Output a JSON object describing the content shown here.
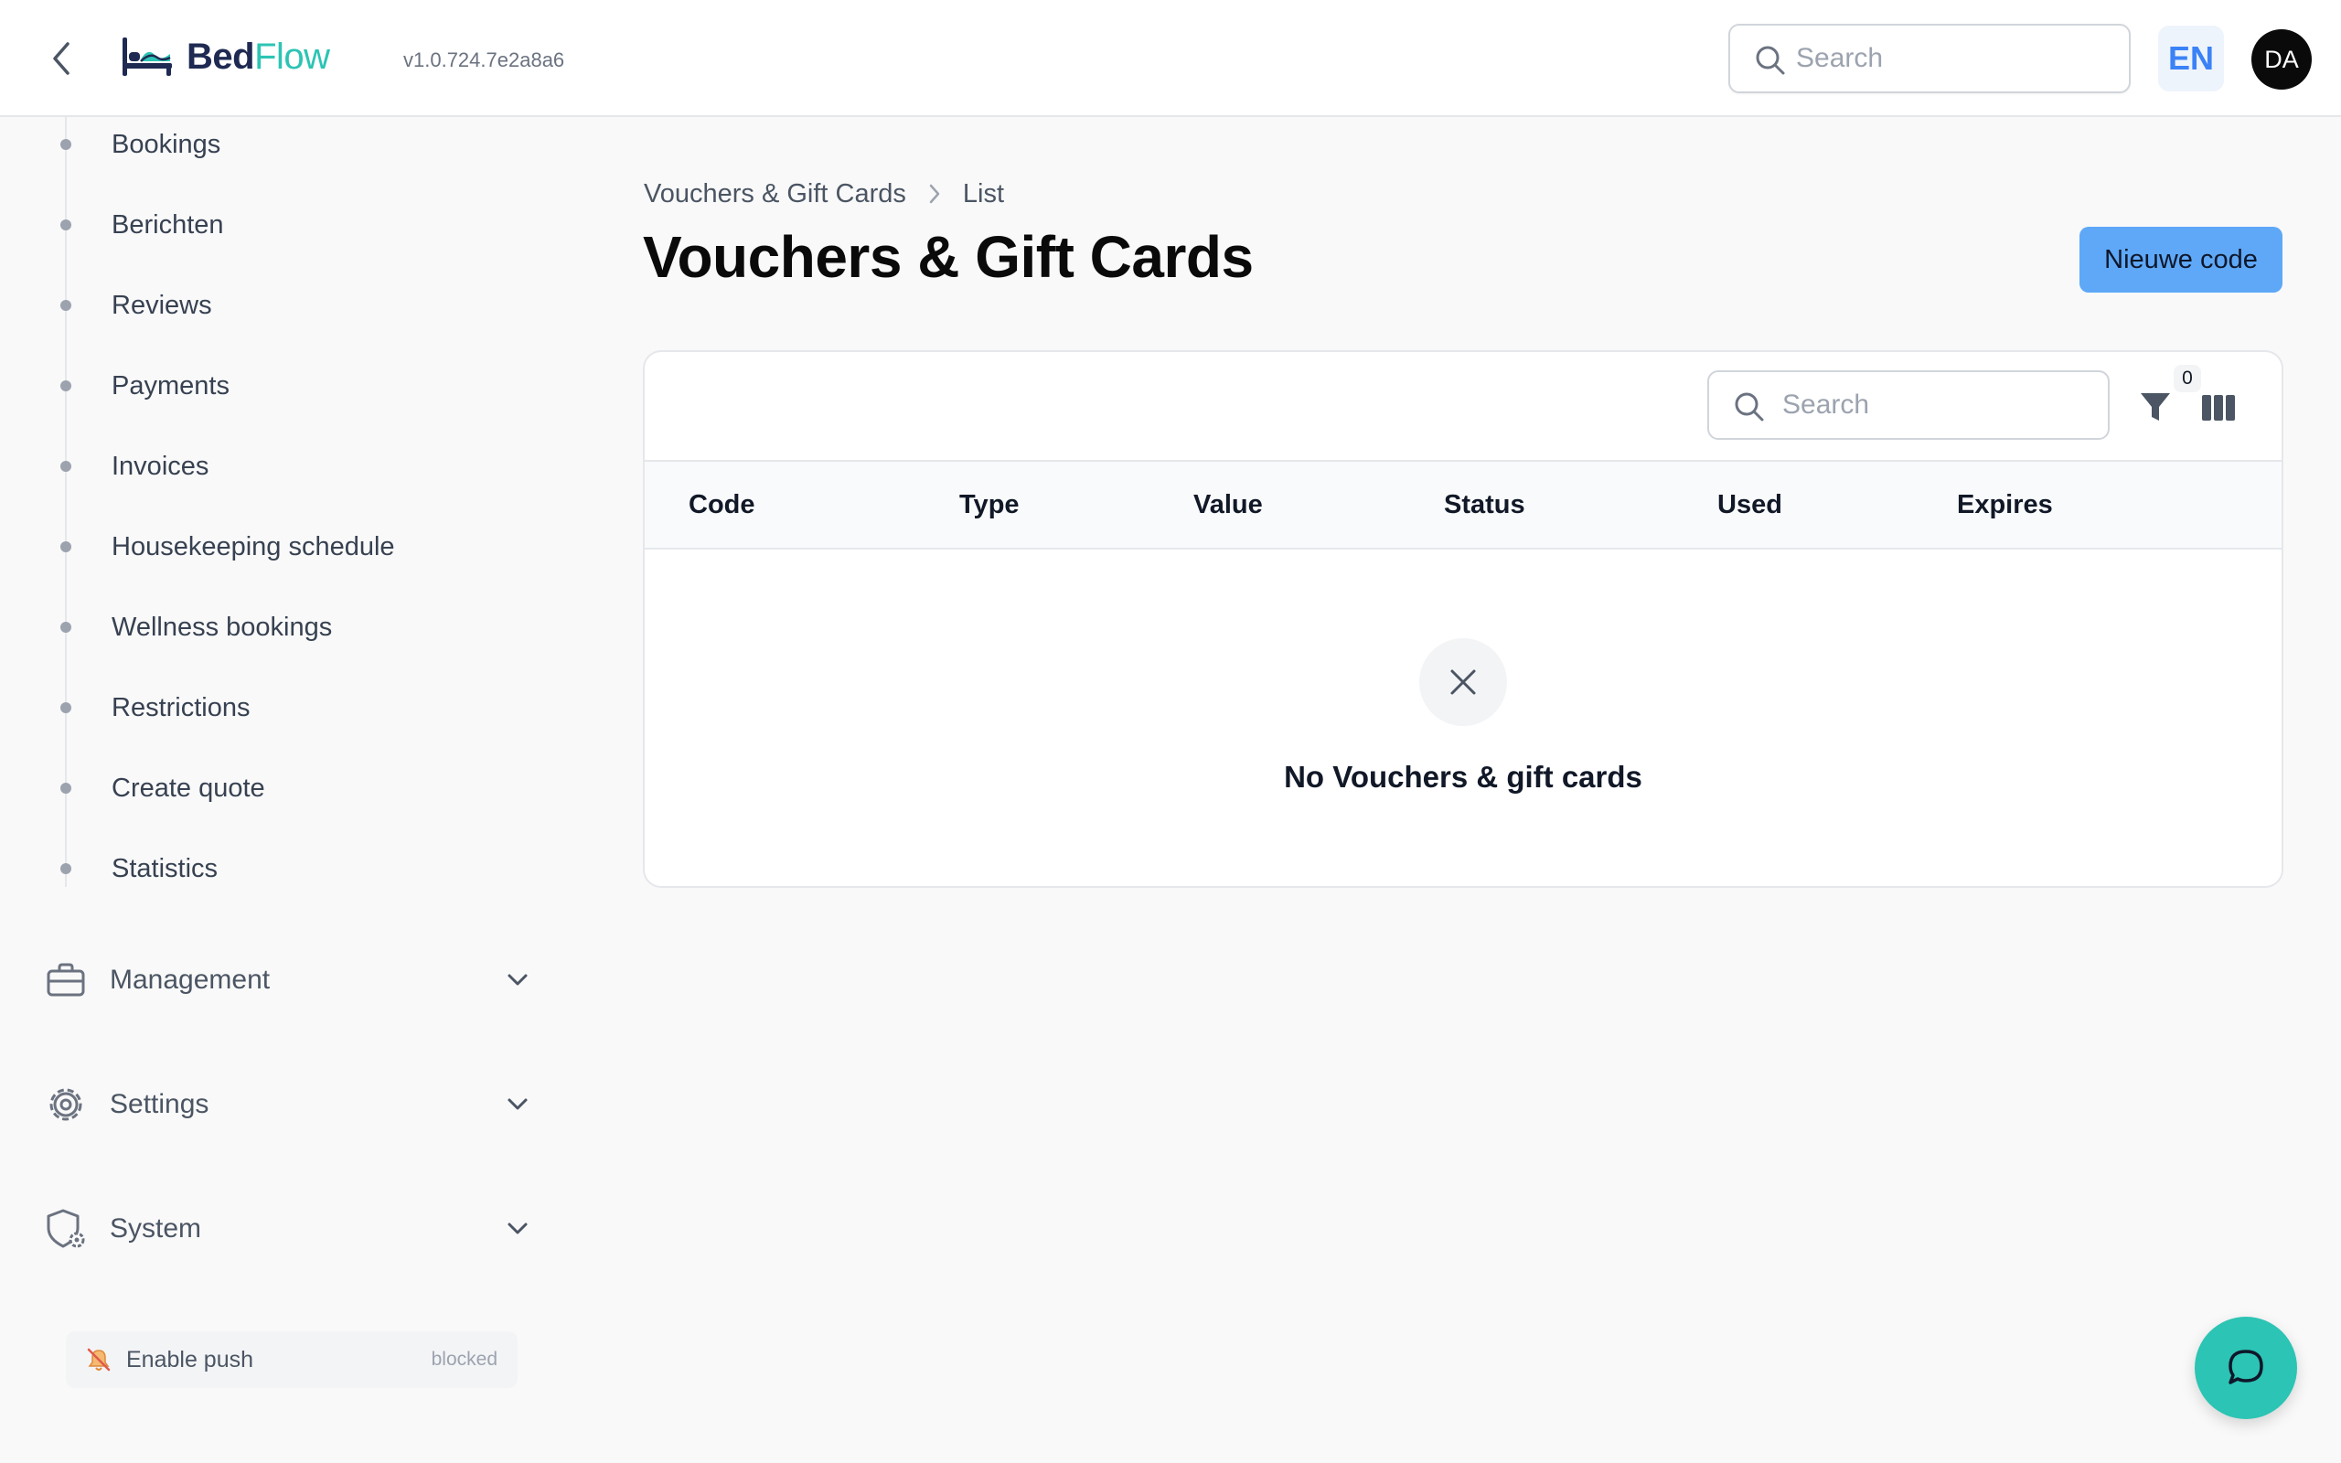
{
  "header": {
    "back_icon": "chevron-left-icon",
    "logo": {
      "part1": "Bed",
      "part2": "Flow",
      "icon": "bed-icon"
    },
    "version": "v1.0.724.7e2a8a6",
    "search_placeholder": "Search",
    "language": "EN",
    "avatar_initials": "DA"
  },
  "sidebar": {
    "items": [
      {
        "label": "Bookings"
      },
      {
        "label": "Berichten"
      },
      {
        "label": "Reviews"
      },
      {
        "label": "Payments"
      },
      {
        "label": "Invoices"
      },
      {
        "label": "Housekeeping schedule"
      },
      {
        "label": "Wellness bookings"
      },
      {
        "label": "Restrictions"
      },
      {
        "label": "Create quote"
      },
      {
        "label": "Statistics"
      }
    ],
    "groups": [
      {
        "label": "Management",
        "icon": "briefcase-icon"
      },
      {
        "label": "Settings",
        "icon": "gear-icon"
      },
      {
        "label": "System",
        "icon": "shield-gear-icon"
      }
    ],
    "push": {
      "label": "Enable push",
      "status": "blocked",
      "icon": "bell-off-icon"
    }
  },
  "main": {
    "breadcrumb": [
      "Vouchers & Gift Cards",
      "List"
    ],
    "title": "Vouchers & Gift Cards",
    "new_button": "Nieuwe code",
    "table": {
      "search_placeholder": "Search",
      "filter_count": "0",
      "columns": [
        "Code",
        "Type",
        "Value",
        "Status",
        "Used",
        "Expires"
      ],
      "empty_message": "No Vouchers & gift cards"
    }
  },
  "colors": {
    "accent_blue": "#5ea8f7",
    "brand_teal": "#2cc4b4",
    "brand_navy": "#1e2a52"
  },
  "chat_icon": "chat-bubble-icon"
}
